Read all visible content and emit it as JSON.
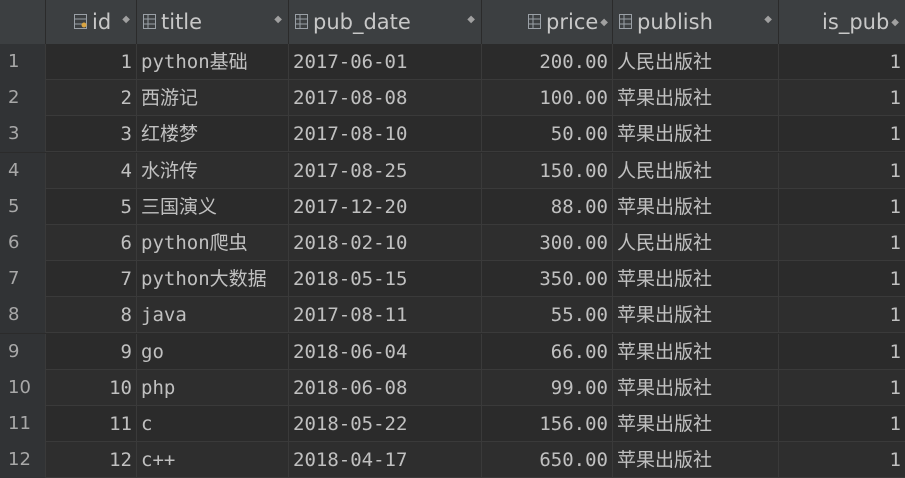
{
  "columns": [
    {
      "key": "id",
      "label": "id",
      "icon": "primary-key-column-icon"
    },
    {
      "key": "title",
      "label": "title",
      "icon": "column-icon"
    },
    {
      "key": "pub_date",
      "label": "pub_date",
      "icon": "column-icon"
    },
    {
      "key": "price",
      "label": "price",
      "icon": "column-icon"
    },
    {
      "key": "publish",
      "label": "publish",
      "icon": "column-icon"
    },
    {
      "key": "is_pub",
      "label": "is_pub",
      "icon": "column-icon"
    }
  ],
  "rows": [
    {
      "rownum": "1",
      "id": "1",
      "title": "python基础",
      "pub_date": "2017-06-01",
      "price": "200.00",
      "publish": "人民出版社",
      "is_pub": "1"
    },
    {
      "rownum": "2",
      "id": "2",
      "title": "西游记",
      "pub_date": "2017-08-08",
      "price": "100.00",
      "publish": "苹果出版社",
      "is_pub": "1"
    },
    {
      "rownum": "3",
      "id": "3",
      "title": "红楼梦",
      "pub_date": "2017-08-10",
      "price": "50.00",
      "publish": "苹果出版社",
      "is_pub": "1"
    },
    {
      "rownum": "4",
      "id": "4",
      "title": "水浒传",
      "pub_date": "2017-08-25",
      "price": "150.00",
      "publish": "人民出版社",
      "is_pub": "1"
    },
    {
      "rownum": "5",
      "id": "5",
      "title": "三国演义",
      "pub_date": "2017-12-20",
      "price": "88.00",
      "publish": "苹果出版社",
      "is_pub": "1"
    },
    {
      "rownum": "6",
      "id": "6",
      "title": "python爬虫",
      "pub_date": "2018-02-10",
      "price": "300.00",
      "publish": "人民出版社",
      "is_pub": "1"
    },
    {
      "rownum": "7",
      "id": "7",
      "title": "python大数据",
      "pub_date": "2018-05-15",
      "price": "350.00",
      "publish": "苹果出版社",
      "is_pub": "1"
    },
    {
      "rownum": "8",
      "id": "8",
      "title": "java",
      "pub_date": "2017-08-11",
      "price": "55.00",
      "publish": "苹果出版社",
      "is_pub": "1"
    },
    {
      "rownum": "9",
      "id": "9",
      "title": "go",
      "pub_date": "2018-06-04",
      "price": "66.00",
      "publish": "苹果出版社",
      "is_pub": "1"
    },
    {
      "rownum": "10",
      "id": "10",
      "title": "php",
      "pub_date": "2018-06-08",
      "price": "99.00",
      "publish": "苹果出版社",
      "is_pub": "1"
    },
    {
      "rownum": "11",
      "id": "11",
      "title": "c",
      "pub_date": "2018-05-22",
      "price": "156.00",
      "publish": "苹果出版社",
      "is_pub": "1"
    },
    {
      "rownum": "12",
      "id": "12",
      "title": "c++",
      "pub_date": "2018-04-17",
      "price": "650.00",
      "publish": "苹果出版社",
      "is_pub": "1"
    }
  ]
}
